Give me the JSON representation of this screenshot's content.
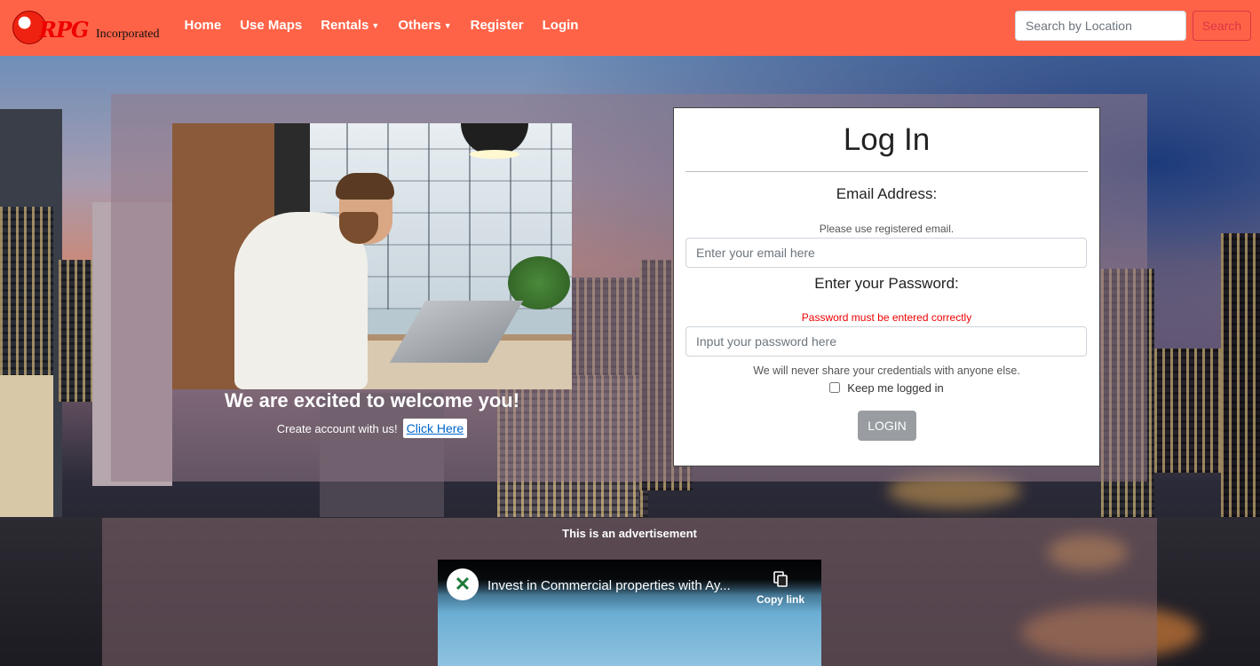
{
  "brand": {
    "logo_text": "RPG",
    "tagline": "Incorporated"
  },
  "nav": {
    "items": [
      {
        "label": "Home"
      },
      {
        "label": "Use Maps"
      },
      {
        "label": "Rentals",
        "dropdown": true
      },
      {
        "label": "Others",
        "dropdown": true
      },
      {
        "label": "Register"
      },
      {
        "label": "Login"
      }
    ],
    "search_placeholder": "Search by Location",
    "search_button": "Search"
  },
  "welcome": {
    "title": "We are excited to welcome you!",
    "line": "Create account with us!",
    "link": "Click Here"
  },
  "login": {
    "title": "Log In",
    "email_label": "Email Address:",
    "email_hint": "Please use registered email.",
    "email_placeholder": "Enter your email here",
    "password_label": "Enter your Password:",
    "password_hint": "Password must be entered correctly",
    "password_placeholder": "Input your password here",
    "privacy_note": "We will never share your credentials with anyone else.",
    "remember_label": "Keep me logged in",
    "remember_checked": false,
    "submit": "LOGIN"
  },
  "ad": {
    "label": "This is an advertisement",
    "video_title": "Invest in Commercial properties with Ay...",
    "copy_label": "Copy link"
  },
  "colors": {
    "navbar": "#ff6347",
    "search_button": "#dc3545",
    "login_button": "#999da2",
    "password_hint": "#ee0000"
  }
}
